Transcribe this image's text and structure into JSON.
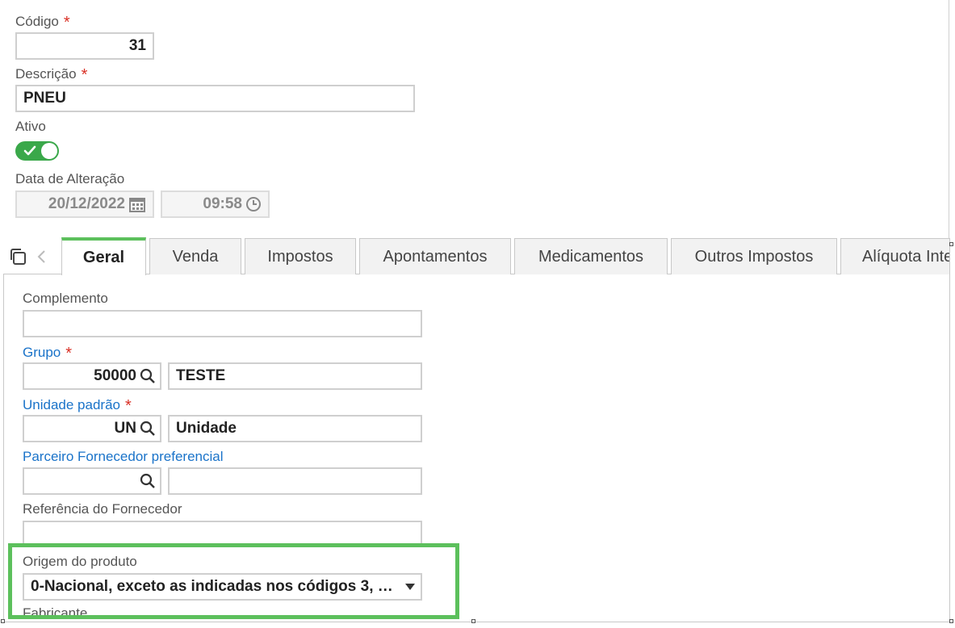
{
  "form": {
    "codigo": {
      "label": "Código",
      "value": "31"
    },
    "descricao": {
      "label": "Descrição",
      "value": "PNEU"
    },
    "ativo": {
      "label": "Ativo",
      "checked": true
    },
    "data_alteracao": {
      "label": "Data de Alteração",
      "date": "20/12/2022",
      "time": "09:58"
    }
  },
  "tabs": [
    {
      "label": "Geral",
      "active": true
    },
    {
      "label": "Venda"
    },
    {
      "label": "Impostos"
    },
    {
      "label": "Apontamentos"
    },
    {
      "label": "Medicamentos"
    },
    {
      "label": "Outros Impostos"
    },
    {
      "label": "Alíquota Inte"
    }
  ],
  "geral": {
    "complemento": {
      "label": "Complemento",
      "value": ""
    },
    "grupo": {
      "label": "Grupo",
      "code": "50000",
      "name": "TESTE"
    },
    "unidade": {
      "label": "Unidade padrão",
      "code": "UN",
      "name": "Unidade"
    },
    "parceiro": {
      "label": "Parceiro Fornecedor preferencial",
      "code": "",
      "name": ""
    },
    "referencia": {
      "label": "Referência do Fornecedor",
      "value": ""
    },
    "origem": {
      "label": "Origem do produto",
      "value": "0-Nacional, exceto as indicadas nos códigos 3, …"
    },
    "fabricante": {
      "label": "Fabricante"
    }
  },
  "colors": {
    "accent": "#5cc05c",
    "link": "#1a73c9",
    "required": "#d93025",
    "toggle": "#3aa84a"
  },
  "required_mark": "*"
}
